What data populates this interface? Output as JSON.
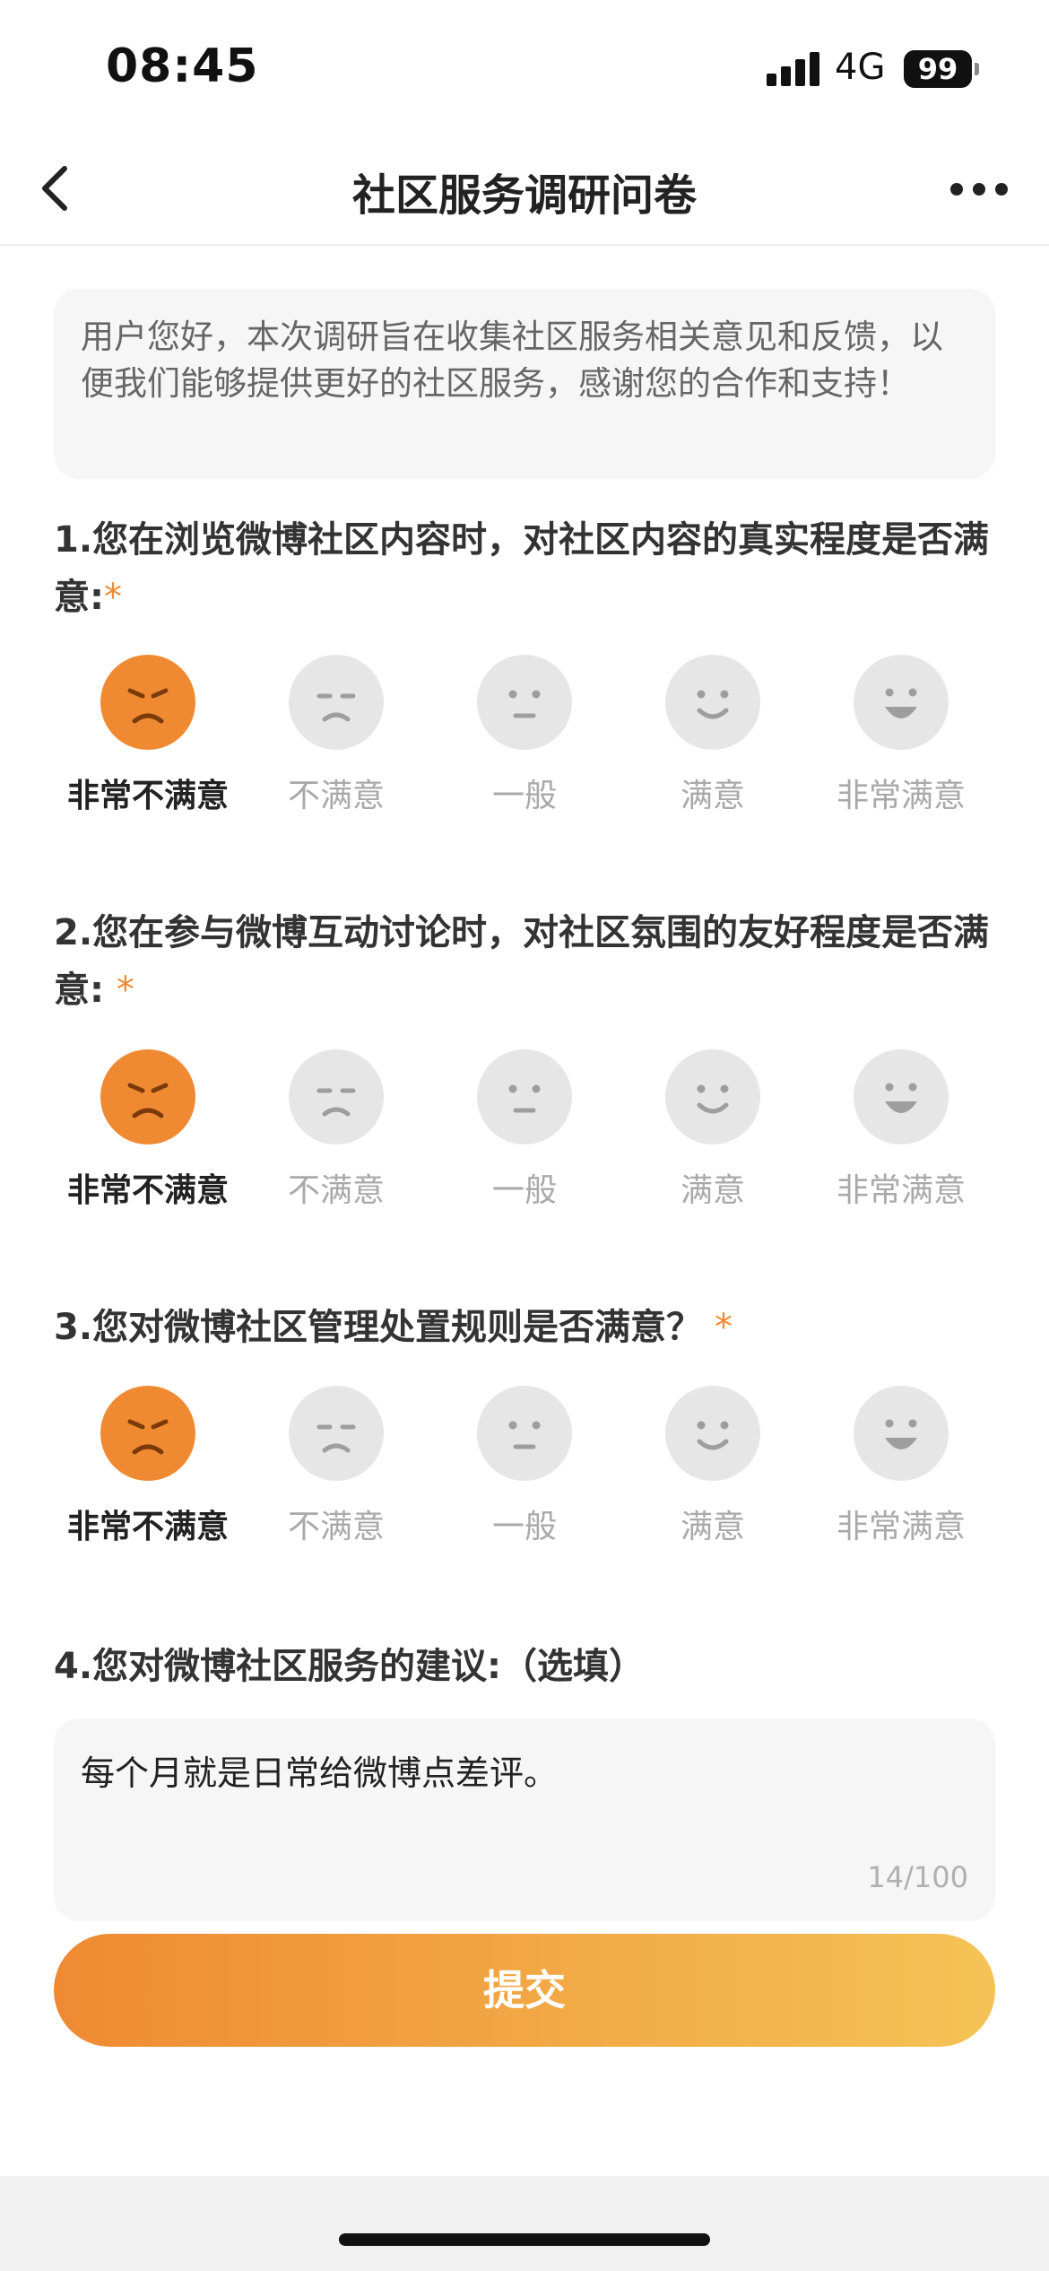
{
  "status_bar": {
    "time": "08:45",
    "network": "4G",
    "battery": "99"
  },
  "nav": {
    "title": "社区服务调研问卷",
    "back_icon": "chevron-left-icon",
    "more_icon": "more-horizontal-icon"
  },
  "intro": {
    "text": "用户您好，本次调研旨在收集社区服务相关意见和反馈，以便我们能够提供更好的社区服务，感谢您的合作和支持！"
  },
  "questions": [
    {
      "title": "1.您在浏览微博社区内容时，对社区内容的真实程度是否满意:",
      "required": "*",
      "selected": "非常不满意"
    },
    {
      "title": "2.您在参与微博互动讨论时，对社区氛围的友好程度是否满意: ",
      "required": "*",
      "selected": "非常不满意"
    },
    {
      "title": "3.您对微博社区管理处置规则是否满意？ ",
      "required": "*",
      "selected": "非常不满意"
    }
  ],
  "rating_options": [
    "非常不满意",
    "不满意",
    "一般",
    "满意",
    "非常满意"
  ],
  "suggestion": {
    "title": "4.您对微博社区服务的建议:（选填）",
    "value": "每个月就是日常给微博点差评。",
    "count": "14/100"
  },
  "submit_label": "提交",
  "colors": {
    "accent": "#f08a32",
    "gradient_end": "#f4c356",
    "inactive_face": "#e6e6e6"
  }
}
